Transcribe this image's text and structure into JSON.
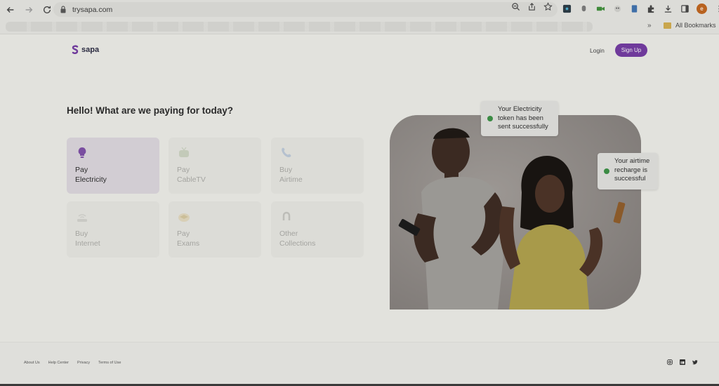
{
  "browser": {
    "url": "trysapa.com",
    "bookmarks_more": "»",
    "all_bookmarks": "All Bookmarks",
    "profile_initial": "e",
    "profile_color": "#b8621f"
  },
  "header": {
    "logo_text": "sapa",
    "login": "Login",
    "signup": "Sign Up",
    "accent_color": "#6f3a9b"
  },
  "main": {
    "headline": "Hello! What are we paying for today?",
    "services": [
      {
        "line1": "Pay",
        "line2": "Electricity",
        "icon": "lightbulb-icon",
        "active": true
      },
      {
        "line1": "Pay",
        "line2": "CableTV",
        "icon": "tv-icon",
        "active": false
      },
      {
        "line1": "Buy",
        "line2": "Airtime",
        "icon": "phone-icon",
        "active": false
      },
      {
        "line1": "Buy",
        "line2": "Internet",
        "icon": "router-icon",
        "active": false
      },
      {
        "line1": "Pay",
        "line2": "Exams",
        "icon": "graduation-cap-icon",
        "active": false
      },
      {
        "line1": "Other",
        "line2": "Collections",
        "icon": "magnet-icon",
        "active": false
      }
    ]
  },
  "hero": {
    "toast1": {
      "line1": "Your Electricity",
      "line2": "token has been",
      "line3": "sent successfully"
    },
    "toast2": {
      "line1": "Your airtime",
      "line2": "recharge is",
      "line3": "successful"
    },
    "success_color": "#3b8b44"
  },
  "footer": {
    "links": [
      "About Us",
      "Help Center",
      "Privacy",
      "Terms of Use"
    ],
    "socials": [
      "instagram-icon",
      "linkedin-icon",
      "twitter-icon"
    ]
  }
}
